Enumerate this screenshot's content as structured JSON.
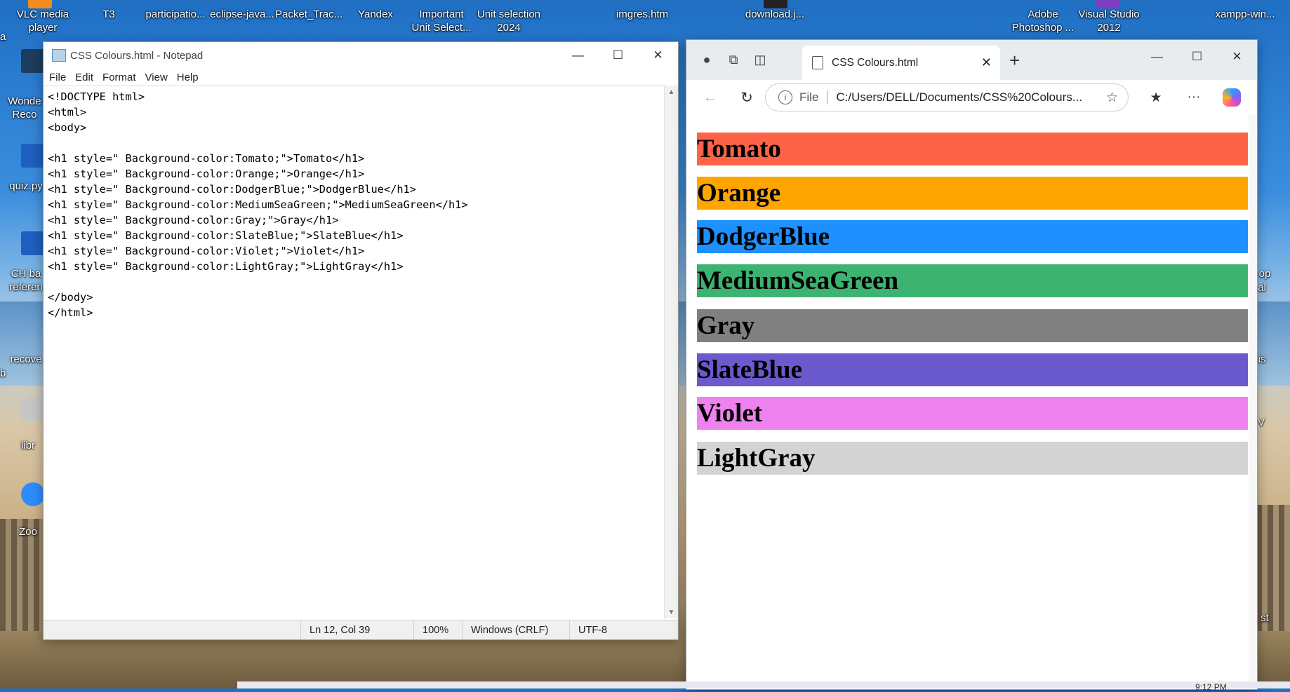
{
  "desktop": {
    "top_icons": [
      {
        "label": "VLC media\nplayer"
      },
      {
        "label": "T3"
      },
      {
        "label": "participatio..."
      },
      {
        "label": "eclipse-java..."
      },
      {
        "label": "Packet_Trac..."
      },
      {
        "label": "Yandex"
      },
      {
        "label": "Important\nUnit Select..."
      },
      {
        "label": "Unit selection\n2024"
      },
      {
        "label": "imgres.htm"
      },
      {
        "label": "download.j..."
      },
      {
        "label": "Adobe\nPhotoshop ..."
      },
      {
        "label": "Visual Studio\n2012"
      },
      {
        "label": "xampp-win..."
      }
    ],
    "left_icons": [
      {
        "label": "Wonde\nReco"
      },
      {
        "label": "quiz.py"
      },
      {
        "label": "CH ba\nreferen"
      },
      {
        "label": "recove"
      },
      {
        "label": "libr"
      },
      {
        "label": "Zoo"
      }
    ],
    "left_edge_texts": [
      "a",
      "b"
    ],
    "right_edge_texts": [
      "op",
      "al",
      "is",
      "V",
      "st"
    ],
    "taskbar_time": "9:12 PM"
  },
  "notepad": {
    "title": "CSS Colours.html - Notepad",
    "menu": [
      "File",
      "Edit",
      "Format",
      "View",
      "Help"
    ],
    "content": "<!DOCTYPE html>\n<html>\n<body>\n\n<h1 style=\" Background-color:Tomato;\">Tomato</h1>\n<h1 style=\" Background-color:Orange;\">Orange</h1>\n<h1 style=\" Background-color:DodgerBlue;\">DodgerBlue</h1>\n<h1 style=\" Background-color:MediumSeaGreen;\">MediumSeaGreen</h1>\n<h1 style=\" Background-color:Gray;\">Gray</h1>\n<h1 style=\" Background-color:SlateBlue;\">SlateBlue</h1>\n<h1 style=\" Background-color:Violet;\">Violet</h1>\n<h1 style=\" Background-color:LightGray;\">LightGray</h1>\n\n</body>\n</html>",
    "status": {
      "position": "Ln 12, Col 39",
      "zoom": "100%",
      "line_ending": "Windows (CRLF)",
      "encoding": "UTF-8"
    }
  },
  "browser": {
    "tab_title": "CSS Colours.html",
    "address_scheme": "File",
    "address": "C:/Users/DELL/Documents/CSS%20Colours...",
    "headings": [
      {
        "text": "Tomato",
        "color": "#ff6347"
      },
      {
        "text": "Orange",
        "color": "#ffa500"
      },
      {
        "text": "DodgerBlue",
        "color": "#1e90ff"
      },
      {
        "text": "MediumSeaGreen",
        "color": "#3cb371"
      },
      {
        "text": "Gray",
        "color": "#808080"
      },
      {
        "text": "SlateBlue",
        "color": "#6a5acd"
      },
      {
        "text": "Violet",
        "color": "#ee82ee"
      },
      {
        "text": "LightGray",
        "color": "#d3d3d3"
      }
    ]
  }
}
